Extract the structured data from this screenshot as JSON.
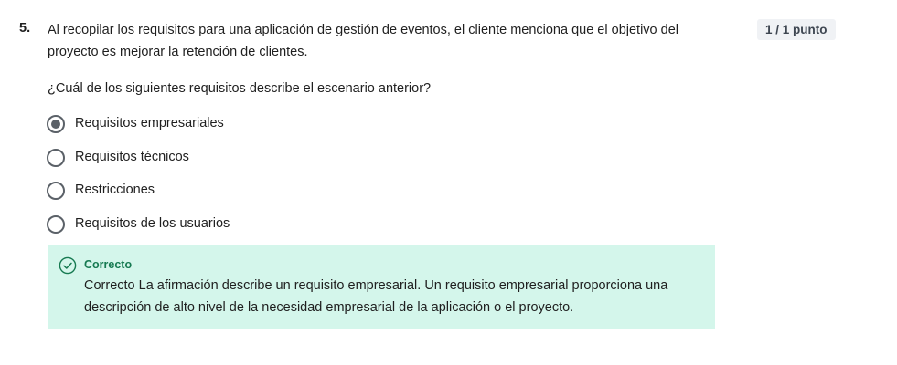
{
  "question": {
    "number": "5.",
    "text": "Al recopilar los requisitos para una aplicación de gestión de eventos, el cliente menciona que el objetivo del proyecto es mejorar la retención de clientes.",
    "prompt": "¿Cuál de los siguientes requisitos describe el escenario anterior?",
    "score": "1 / 1 punto"
  },
  "options": [
    {
      "label": "Requisitos empresariales",
      "selected": true
    },
    {
      "label": "Requisitos técnicos",
      "selected": false
    },
    {
      "label": "Restricciones",
      "selected": false
    },
    {
      "label": "Requisitos de los usuarios",
      "selected": false
    }
  ],
  "feedback": {
    "title": "Correcto",
    "text": "Correcto La afirmación describe un requisito empresarial. Un requisito empresarial proporciona una descripción de alto nivel de la necesidad empresarial de la aplicación o el proyecto.",
    "icon": "check-circle-icon",
    "accent_color": "#167a51",
    "background_color": "#d4f6eb"
  }
}
